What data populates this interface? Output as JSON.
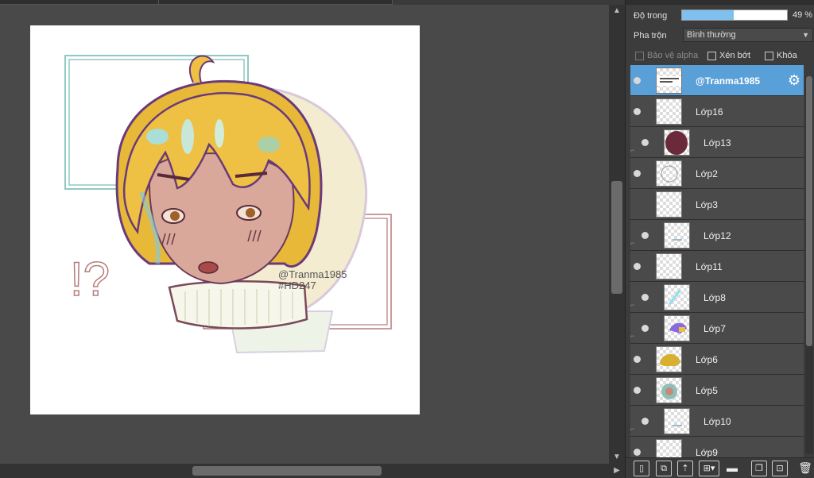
{
  "panel": {
    "opacity_label": "Độ trong",
    "opacity_value": "49 %",
    "opacity_fraction": 0.49,
    "blend_label": "Pha trộn",
    "blend_value": "Bình thường",
    "protect_alpha_label": "Bảo vệ alpha",
    "clipping_label": "Xén bớt",
    "lock_label": "Khóa"
  },
  "artwork": {
    "watermark_name": "@Tranma1985",
    "watermark_tag": "#HD247",
    "exclaim_text": "!?"
  },
  "layers": [
    {
      "name": "@Tranma1985",
      "active": true,
      "clip": false,
      "thumb": "text"
    },
    {
      "name": "Lớp16",
      "active": false,
      "clip": false,
      "thumb": "empty"
    },
    {
      "name": "Lớp13",
      "active": false,
      "clip": true,
      "thumb": "purple"
    },
    {
      "name": "Lớp2",
      "active": false,
      "clip": false,
      "thumb": "sketch"
    },
    {
      "name": "Lớp3",
      "active": false,
      "clip": false,
      "hidden": true,
      "thumb": "empty"
    },
    {
      "name": "Lớp12",
      "active": false,
      "clip": true,
      "thumb": "dots"
    },
    {
      "name": "Lớp11",
      "active": false,
      "clip": false,
      "thumb": "empty"
    },
    {
      "name": "Lớp8",
      "active": false,
      "clip": true,
      "thumb": "cyan"
    },
    {
      "name": "Lớp7",
      "active": false,
      "clip": true,
      "thumb": "violet"
    },
    {
      "name": "Lớp6",
      "active": false,
      "clip": false,
      "thumb": "hair"
    },
    {
      "name": "Lớp5",
      "active": false,
      "clip": false,
      "thumb": "face"
    },
    {
      "name": "Lớp10",
      "active": false,
      "clip": true,
      "thumb": "dots"
    },
    {
      "name": "Lớp9",
      "active": false,
      "clip": false,
      "thumb": "empty"
    }
  ],
  "colors": {
    "active_layer": "#5aa0d8",
    "opacity_fill": "#7fc0ee"
  }
}
